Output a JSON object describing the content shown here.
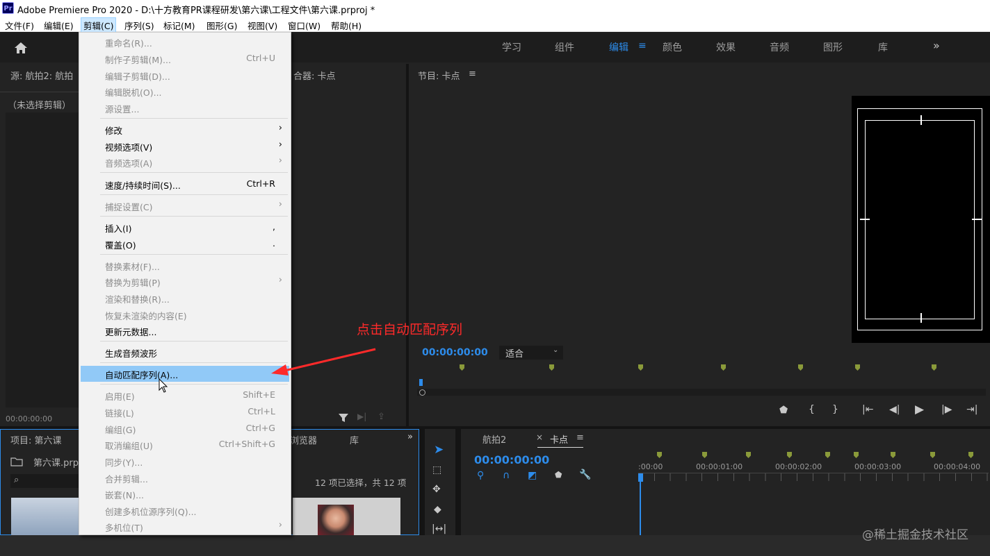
{
  "window": {
    "title": "Adobe Premiere Pro 2020 - D:\\十方教育PR课程研发\\第六课\\工程文件\\第六课.prproj *",
    "app_logo": "Pr"
  },
  "menubar": [
    "文件(F)",
    "编辑(E)",
    "剪辑(C)",
    "序列(S)",
    "标记(M)",
    "图形(G)",
    "视图(V)",
    "窗口(W)",
    "帮助(H)"
  ],
  "workspaces": {
    "tabs": [
      "学习",
      "组件",
      "编辑",
      "颜色",
      "效果",
      "音频",
      "图形",
      "库"
    ],
    "active": "编辑",
    "menu_icon": "≡",
    "more": "»"
  },
  "source_panel": {
    "title": "源: 航拍2: 航拍",
    "mixer_tail": "合器: 卡点",
    "no_clip": "（未选择剪辑）",
    "timecode": "00:00:00:00"
  },
  "program_panel": {
    "title": "节目: 卡点",
    "menu_icon": "≡",
    "timecode": "00:00:00:00",
    "fit": "适合"
  },
  "project_panel": {
    "title": "项目: 第六课",
    "file": "第六课.prpr",
    "browser_tail": "浏览器",
    "library": "库",
    "more": "»",
    "selection_info": "12 项已选择，共 12 项"
  },
  "timeline": {
    "tab1": "航拍2",
    "close": "×",
    "tab2": "卡点",
    "menu_icon": "≡",
    "timecode": "00:00:00:00",
    "ruler": [
      ":00:00",
      "00:00:01:00",
      "00:00:02:00",
      "00:00:03:00",
      "00:00:04:00"
    ]
  },
  "clip_menu": {
    "items": [
      {
        "label": "重命名(R)...",
        "shortcut": "",
        "disabled": true,
        "submenu": false
      },
      {
        "label": "制作子剪辑(M)...",
        "shortcut": "Ctrl+U",
        "disabled": true,
        "submenu": false
      },
      {
        "label": "编辑子剪辑(D)...",
        "shortcut": "",
        "disabled": true,
        "submenu": false
      },
      {
        "label": "编辑脱机(O)...",
        "shortcut": "",
        "disabled": true,
        "submenu": false
      },
      {
        "label": "源设置...",
        "shortcut": "",
        "disabled": true,
        "submenu": false
      },
      {
        "label": "修改",
        "shortcut": "",
        "disabled": false,
        "submenu": true
      },
      {
        "label": "视频选项(V)",
        "shortcut": "",
        "disabled": false,
        "submenu": true
      },
      {
        "label": "音频选项(A)",
        "shortcut": "",
        "disabled": true,
        "submenu": true
      },
      {
        "label": "速度/持续时间(S)...",
        "shortcut": "Ctrl+R",
        "disabled": false,
        "submenu": false
      },
      {
        "label": "捕捉设置(C)",
        "shortcut": "",
        "disabled": true,
        "submenu": true
      },
      {
        "label": "插入(I)",
        "shortcut": ",",
        "disabled": false,
        "submenu": false
      },
      {
        "label": "覆盖(O)",
        "shortcut": ".",
        "disabled": false,
        "submenu": false
      },
      {
        "label": "替换素材(F)...",
        "shortcut": "",
        "disabled": true,
        "submenu": false
      },
      {
        "label": "替换为剪辑(P)",
        "shortcut": "",
        "disabled": true,
        "submenu": true
      },
      {
        "label": "渲染和替换(R)...",
        "shortcut": "",
        "disabled": true,
        "submenu": false
      },
      {
        "label": "恢复未渲染的内容(E)",
        "shortcut": "",
        "disabled": true,
        "submenu": false
      },
      {
        "label": "更新元数据...",
        "shortcut": "",
        "disabled": false,
        "submenu": false
      },
      {
        "label": "生成音频波形",
        "shortcut": "",
        "disabled": false,
        "submenu": false
      },
      {
        "label": "自动匹配序列(A)...",
        "shortcut": "",
        "disabled": false,
        "submenu": false,
        "highlighted": true
      },
      {
        "label": "启用(E)",
        "shortcut": "Shift+E",
        "disabled": true,
        "submenu": false
      },
      {
        "label": "链接(L)",
        "shortcut": "Ctrl+L",
        "disabled": true,
        "submenu": false
      },
      {
        "label": "编组(G)",
        "shortcut": "Ctrl+G",
        "disabled": true,
        "submenu": false
      },
      {
        "label": "取消编组(U)",
        "shortcut": "Ctrl+Shift+G",
        "disabled": true,
        "submenu": false
      },
      {
        "label": "同步(Y)...",
        "shortcut": "",
        "disabled": true,
        "submenu": false
      },
      {
        "label": "合并剪辑...",
        "shortcut": "",
        "disabled": true,
        "submenu": false
      },
      {
        "label": "嵌套(N)...",
        "shortcut": "",
        "disabled": true,
        "submenu": false
      },
      {
        "label": "创建多机位源序列(Q)...",
        "shortcut": "",
        "disabled": true,
        "submenu": false
      },
      {
        "label": "多机位(T)",
        "shortcut": "",
        "disabled": true,
        "submenu": true
      }
    ]
  },
  "annotation": "点击自动匹配序列",
  "watermark": "@稀土掘金技术社区",
  "colors": {
    "accent_blue": "#2d8ceb",
    "annotation_red": "#ff2a2a",
    "marker_green": "#8a9a3a",
    "menu_highlight": "#91c9f7"
  }
}
